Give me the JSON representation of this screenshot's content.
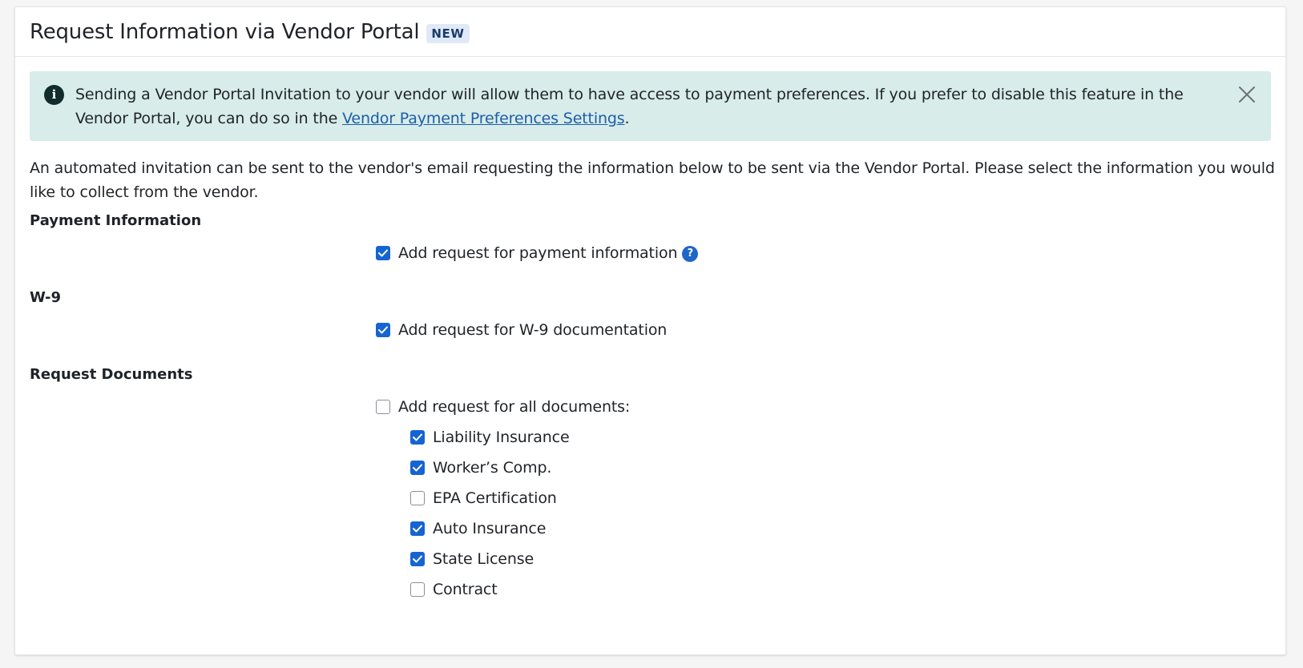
{
  "header": {
    "title": "Request Information via Vendor Portal",
    "badge": "NEW"
  },
  "alert": {
    "icon": "info-icon",
    "text_before": "Sending a Vendor Portal Invitation to your vendor will allow them to have access to payment preferences. If you prefer to disable this feature in the Vendor Portal, you can do so in the ",
    "link_text": "Vendor Payment Preferences Settings",
    "text_after": ".",
    "close_icon": "close-icon"
  },
  "intro": "An automated invitation can be sent to the vendor's email requesting the information below to be sent via the Vendor Portal. Please select the information you would like to collect from the vendor.",
  "payment": {
    "label": "Payment Information",
    "checkbox_label": "Add request for payment information",
    "checked": true,
    "help_glyph": "?"
  },
  "w9": {
    "label": "W-9",
    "checkbox_label": "Add request for W-9 documentation",
    "checked": true
  },
  "documents": {
    "label": "Request Documents",
    "all_label": "Add request for all documents:",
    "all_checked": false,
    "items": [
      {
        "label": "Liability Insurance",
        "checked": true
      },
      {
        "label": "Worker’s Comp.",
        "checked": true
      },
      {
        "label": "EPA Certification",
        "checked": false
      },
      {
        "label": "Auto Insurance",
        "checked": true
      },
      {
        "label": "State License",
        "checked": true
      },
      {
        "label": "Contract",
        "checked": false
      }
    ]
  },
  "colors": {
    "checkbox_on": "#1664d2",
    "alert_bg": "#d8ecea",
    "link": "#1d5ea8"
  }
}
